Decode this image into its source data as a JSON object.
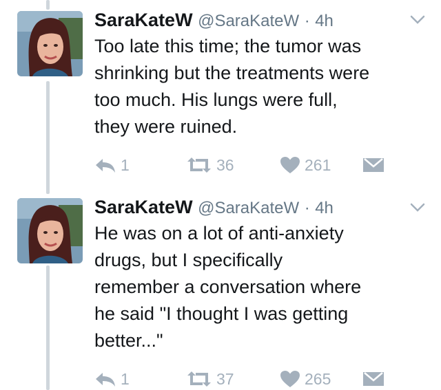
{
  "tweets": [
    {
      "name": "SaraKateW",
      "handle": "@SaraKateW",
      "separator": "·",
      "time": "4h",
      "lines": [
        "Too late this time; the tumor was",
        "shrinking but the treatments were",
        "too much. His lungs were full,",
        "they were ruined."
      ],
      "reply_count": "1",
      "retweet_count": "36",
      "like_count": "261"
    },
    {
      "name": "SaraKateW",
      "handle": "@SaraKateW",
      "separator": "·",
      "time": "4h",
      "lines": [
        "He was on a lot of anti-anxiety",
        "drugs, but I specifically",
        "remember a conversation where",
        "he said \"I thought I was getting",
        "better...\""
      ],
      "reply_count": "1",
      "retweet_count": "37",
      "like_count": "265"
    }
  ],
  "icons": {
    "reply": "reply-icon",
    "retweet": "retweet-icon",
    "like": "heart-icon",
    "message": "envelope-icon",
    "more": "chevron-down-icon"
  },
  "colors": {
    "text": "#14171a",
    "secondary": "#657786",
    "action": "#a4b0bc",
    "thread_line": "#cfd6dc"
  }
}
